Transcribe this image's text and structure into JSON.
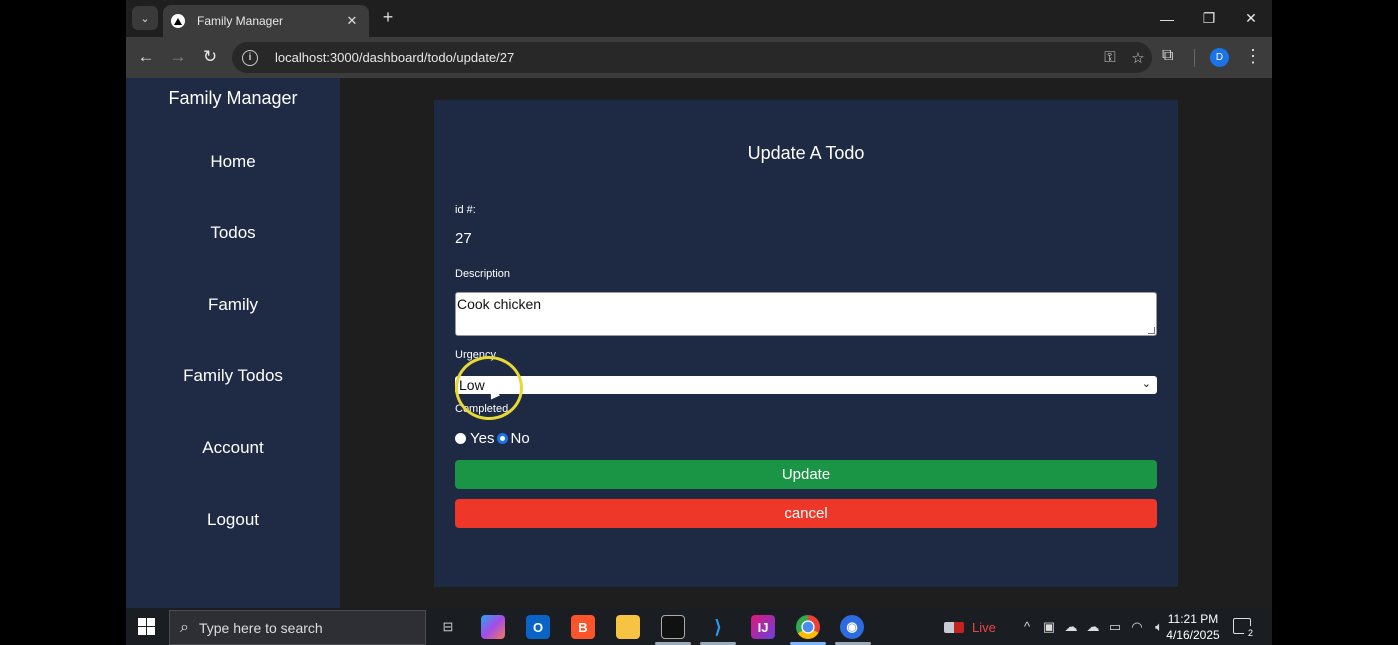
{
  "browser": {
    "tab_title": "Family Manager",
    "url": "localhost:3000/dashboard/todo/update/27",
    "profile_initial": "D",
    "window_controls": {
      "minimize": "—",
      "restore": "❐",
      "close": "✕"
    }
  },
  "sidebar": {
    "brand": "Family Manager",
    "items": [
      {
        "label": "Home"
      },
      {
        "label": "Todos"
      },
      {
        "label": "Family"
      },
      {
        "label": "Family Todos"
      },
      {
        "label": "Account"
      },
      {
        "label": "Logout"
      }
    ]
  },
  "form": {
    "title": "Update A Todo",
    "id_label": "id #:",
    "id_value": "27",
    "description_label": "Description",
    "description_value": "Cook chicken",
    "urgency_label": "Urgency",
    "urgency_value": "Low",
    "completed_label": "Completed",
    "completed_options": [
      "Yes",
      "No"
    ],
    "completed_selected": "No",
    "update_label": "Update",
    "cancel_label": "cancel",
    "colors": {
      "update": "#1a9546",
      "cancel": "#ee3728",
      "card": "#1e2943",
      "sidebar": "#1f2a44"
    }
  },
  "taskbar": {
    "search_placeholder": "Type here to search",
    "live_label": "Live",
    "time": "11:21 PM",
    "date": "4/16/2025",
    "notification_count": "2",
    "pinned_icons": [
      "task-view-icon",
      "copilot-icon",
      "outlook-icon",
      "brave-icon",
      "file-explorer-icon",
      "terminal-icon",
      "vscode-icon",
      "intellij-icon",
      "chrome-icon",
      "app-icon"
    ]
  }
}
